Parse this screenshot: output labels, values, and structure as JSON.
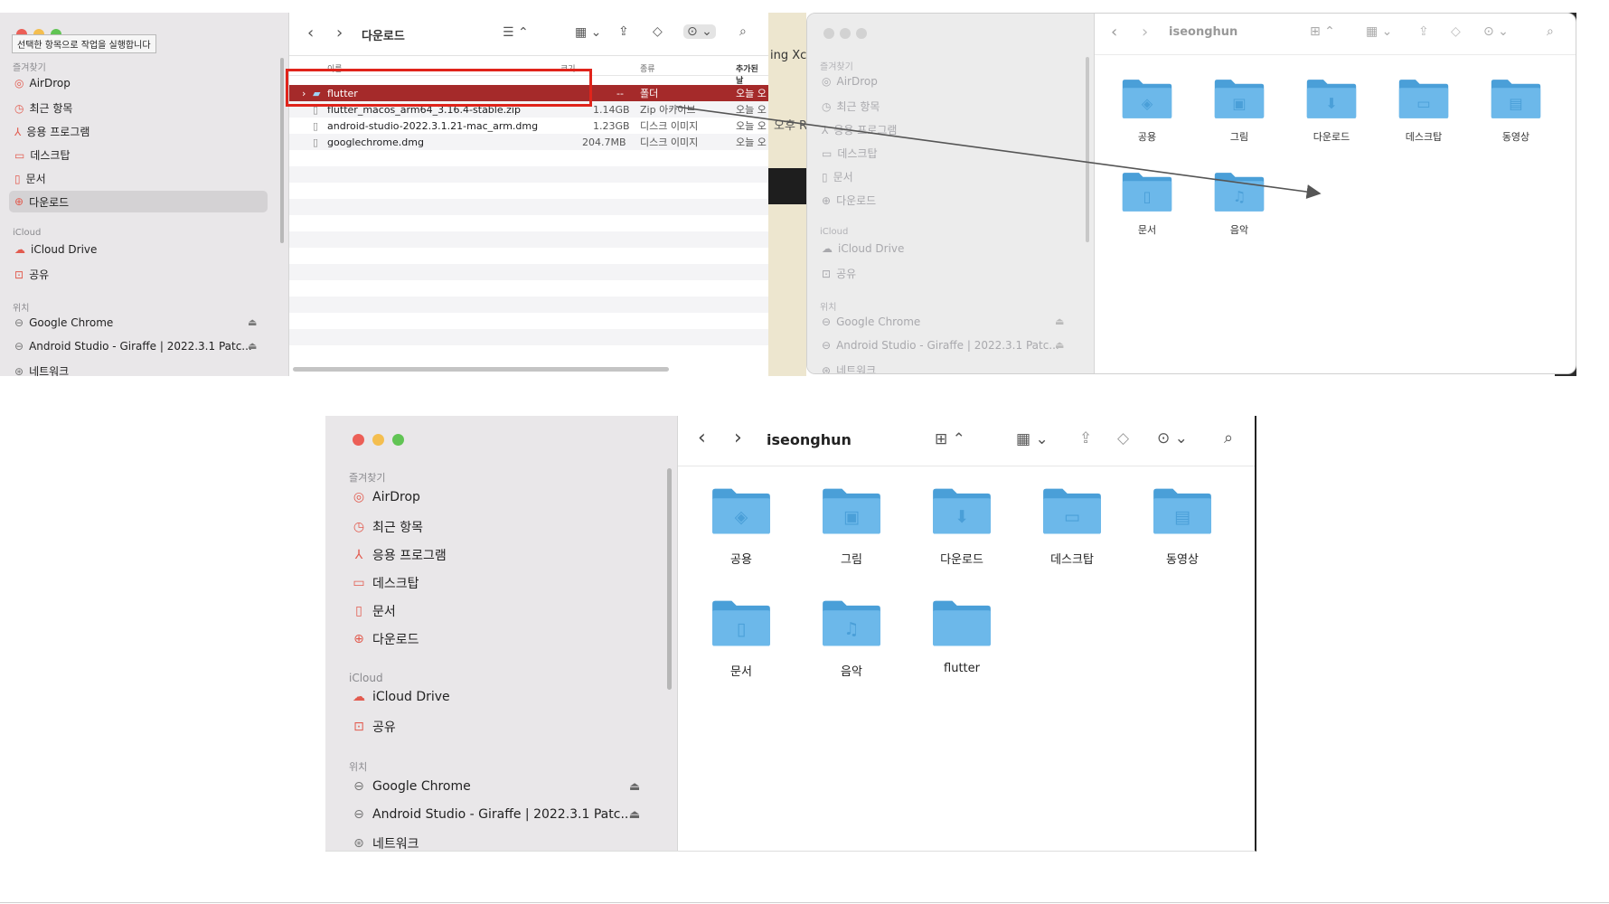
{
  "tooltip": "선택한 항목으로 작업을 실행합니다",
  "background_snippets": {
    "xcode": "ing Xc",
    "rose": "오후 Rose"
  },
  "finder_downloads": {
    "title": "다운로드",
    "sidebar": {
      "favorites_label": "즐겨찾기",
      "favorites": [
        "AirDrop",
        "최근 항목",
        "응용 프로그램",
        "데스크탑",
        "문서",
        "다운로드"
      ],
      "icloud_label": "iCloud",
      "icloud": [
        "iCloud Drive",
        "공유"
      ],
      "locations_label": "위치",
      "locations": [
        "Google Chrome",
        "Android Studio - Giraffe | 2022.3.1 Patc...",
        "네트워크"
      ]
    },
    "columns": {
      "name": "이름",
      "size": "크기",
      "kind": "종류",
      "added": "추가된 날"
    },
    "files": [
      {
        "name": "flutter",
        "size": "--",
        "kind": "폴더",
        "added": "오늘 오"
      },
      {
        "name": "flutter_macos_arm64_3.16.4-stable.zip",
        "size": "1.14GB",
        "kind": "Zip 아카이브",
        "added": "오늘 오"
      },
      {
        "name": "android-studio-2022.3.1.21-mac_arm.dmg",
        "size": "1.23GB",
        "kind": "디스크 이미지",
        "added": "오늘 오"
      },
      {
        "name": "googlechrome.dmg",
        "size": "204.7MB",
        "kind": "디스크 이미지",
        "added": "오늘 오"
      }
    ]
  },
  "finder_home_before": {
    "title": "iseonghun",
    "folders": [
      "공용",
      "그림",
      "다운로드",
      "데스크탑",
      "동영상",
      "문서",
      "음악"
    ]
  },
  "finder_home_after": {
    "title": "iseonghun",
    "sidebar": {
      "favorites_label": "즐겨찾기",
      "favorites": [
        "AirDrop",
        "최근 항목",
        "응용 프로그램",
        "데스크탑",
        "문서",
        "다운로드"
      ],
      "icloud_label": "iCloud",
      "icloud": [
        "iCloud Drive",
        "공유"
      ],
      "locations_label": "위치",
      "locations": [
        "Google Chrome",
        "Android Studio - Giraffe | 2022.3.1 Patc...",
        "네트워크"
      ]
    },
    "folders": [
      "공용",
      "그림",
      "다운로드",
      "데스크탑",
      "동영상",
      "문서",
      "음악",
      "flutter"
    ]
  },
  "colors": {
    "folder": "#6cb8ea",
    "folder_dark": "#4a9fd8",
    "selection": "#a52a2a",
    "highlight_box": "#e0241b",
    "red": "#ec5f57",
    "yellow": "#f4be4f",
    "green": "#61c454"
  }
}
